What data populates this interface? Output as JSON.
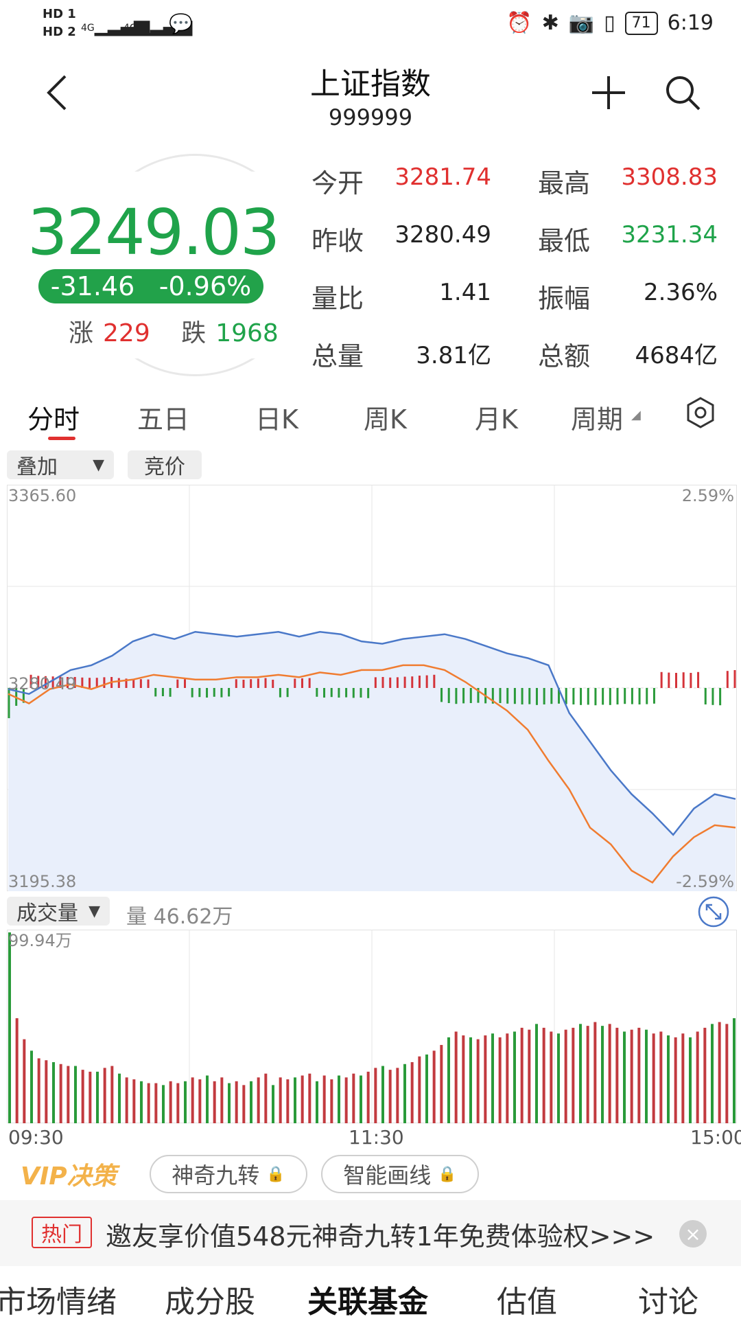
{
  "status_bar": {
    "hd1": "HD 1",
    "hd2": "HD 2",
    "sig1": "4G",
    "sig2": "4G",
    "battery": "71",
    "time": "6:19"
  },
  "header": {
    "title": "上证指数",
    "code": "999999",
    "back_icon": "chevron-left-icon",
    "add_icon": "plus-icon",
    "search_icon": "search-icon"
  },
  "quote": {
    "price": "3249.03",
    "change": "-31.46",
    "change_pct": "-0.96%",
    "up_label": "涨",
    "up_count": "229",
    "down_label": "跌",
    "down_count": "1968",
    "stats": [
      {
        "label": "今开",
        "value": "3281.74",
        "color": "red"
      },
      {
        "label": "最高",
        "value": "3308.83",
        "color": "red"
      },
      {
        "label": "昨收",
        "value": "3280.49",
        "color": "neutral"
      },
      {
        "label": "最低",
        "value": "3231.34",
        "color": "green"
      },
      {
        "label": "量比",
        "value": "1.41",
        "color": "neutral"
      },
      {
        "label": "振幅",
        "value": "2.36%",
        "color": "neutral"
      },
      {
        "label": "总量",
        "value": "3.81亿",
        "color": "neutral"
      },
      {
        "label": "总额",
        "value": "4684亿",
        "color": "neutral"
      }
    ]
  },
  "tabs": [
    "分时",
    "五日",
    "日K",
    "周K",
    "月K",
    "周期"
  ],
  "active_tab": 0,
  "settings_icon": "hexagon-settings-icon",
  "chips": {
    "overlay": "叠加",
    "auction": "竞价"
  },
  "price_chart": {
    "y_max_label": "3365.60",
    "y_min_label": "3195.38",
    "y_mid_label": "3280.49",
    "pct_top": "2.59%",
    "pct_bottom": "-2.59%"
  },
  "volume": {
    "selector": "成交量",
    "label": "量 46.62万",
    "max_label": "99.94万",
    "expand_icon": "expand-arrows-icon"
  },
  "x_labels": [
    "09:30",
    "11:30",
    "15:00"
  ],
  "chart_data": {
    "type": "line",
    "yrange": [
      3195.38,
      3365.6
    ],
    "baseline": 3280.49,
    "series": [
      {
        "color": "#4a78c8",
        "values": [
          3280,
          3278,
          3283,
          3288,
          3290,
          3294,
          3300,
          3303,
          3301,
          3304,
          3303,
          3302,
          3303,
          3304,
          3302,
          3304,
          3303,
          3300,
          3299,
          3301,
          3302,
          3303,
          3301,
          3298,
          3295,
          3293,
          3290,
          3270,
          3258,
          3246,
          3236,
          3228,
          3219,
          3230,
          3236,
          3234
        ]
      },
      {
        "color": "#f07c30",
        "values": [
          3278,
          3274,
          3280,
          3282,
          3280,
          3283,
          3284,
          3286,
          3285,
          3284,
          3284,
          3285,
          3285,
          3286,
          3285,
          3287,
          3286,
          3288,
          3288,
          3290,
          3290,
          3288,
          3283,
          3277,
          3271,
          3263,
          3250,
          3238,
          3222,
          3215,
          3204,
          3199,
          3210,
          3218,
          3223,
          3222
        ]
      }
    ],
    "volume_max": 99.94,
    "volume_values": [
      99.94,
      55,
      44,
      38,
      34,
      33,
      32,
      31,
      30,
      30,
      28,
      27,
      27,
      29,
      30,
      26,
      24,
      23,
      22,
      21,
      21,
      20,
      22,
      21,
      22,
      24,
      23,
      25,
      22,
      24,
      21,
      22,
      20,
      22,
      24,
      26,
      20,
      24,
      23,
      24,
      25,
      26,
      22,
      25,
      23,
      25,
      24,
      26,
      25,
      27,
      29,
      30,
      28,
      29,
      31,
      32,
      35,
      36,
      38,
      41,
      45,
      48,
      46,
      45,
      44,
      46,
      47,
      45,
      47,
      48,
      50,
      49,
      52,
      50,
      48,
      47,
      49,
      50,
      52,
      51,
      53,
      51,
      52,
      50,
      48,
      49,
      50,
      49,
      47,
      48,
      46,
      45,
      47,
      45,
      48,
      50,
      52,
      53,
      52,
      55
    ]
  },
  "features": {
    "vip": "VIP决策",
    "nine": "神奇九转",
    "smart": "智能画线",
    "lock_icon": "lock-icon"
  },
  "promo": {
    "hot": "热门",
    "text": "邀友享价值548元神奇九转1年免费体验权>>>",
    "close_icon": "close-icon"
  },
  "bottom_tabs": [
    "市场情绪",
    "成分股",
    "关联基金",
    "估值",
    "讨论"
  ],
  "active_bottom_tab": 2
}
